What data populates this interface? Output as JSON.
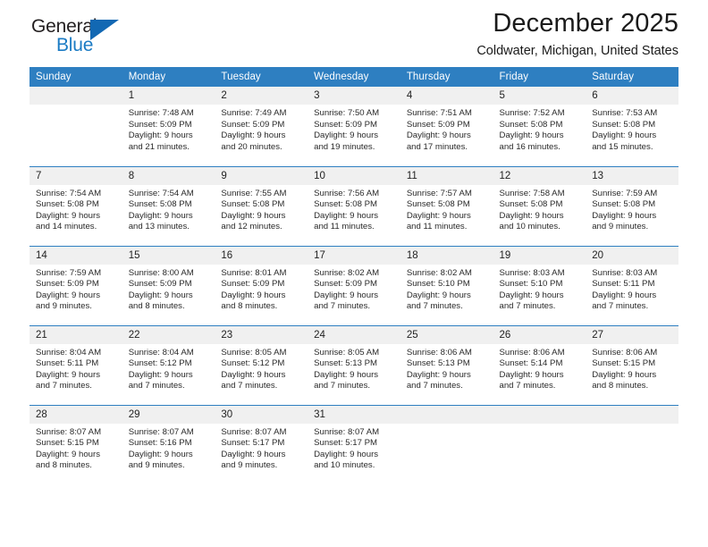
{
  "brand": {
    "name_part1": "General",
    "name_part2": "Blue",
    "triangle_color": "#1268b3",
    "blue_text_color": "#1b7bc4"
  },
  "header": {
    "month_title": "December 2025",
    "location": "Coldwater, Michigan, United States",
    "header_bg_color": "#2e7fc1",
    "daynum_bg_color": "#f0f0f0"
  },
  "weekday_headers": [
    "Sunday",
    "Monday",
    "Tuesday",
    "Wednesday",
    "Thursday",
    "Friday",
    "Saturday"
  ],
  "weeks": [
    [
      {
        "day": "",
        "sunrise": "",
        "sunset": "",
        "daylight1": "",
        "daylight2": ""
      },
      {
        "day": "1",
        "sunrise": "Sunrise: 7:48 AM",
        "sunset": "Sunset: 5:09 PM",
        "daylight1": "Daylight: 9 hours",
        "daylight2": "and 21 minutes."
      },
      {
        "day": "2",
        "sunrise": "Sunrise: 7:49 AM",
        "sunset": "Sunset: 5:09 PM",
        "daylight1": "Daylight: 9 hours",
        "daylight2": "and 20 minutes."
      },
      {
        "day": "3",
        "sunrise": "Sunrise: 7:50 AM",
        "sunset": "Sunset: 5:09 PM",
        "daylight1": "Daylight: 9 hours",
        "daylight2": "and 19 minutes."
      },
      {
        "day": "4",
        "sunrise": "Sunrise: 7:51 AM",
        "sunset": "Sunset: 5:09 PM",
        "daylight1": "Daylight: 9 hours",
        "daylight2": "and 17 minutes."
      },
      {
        "day": "5",
        "sunrise": "Sunrise: 7:52 AM",
        "sunset": "Sunset: 5:08 PM",
        "daylight1": "Daylight: 9 hours",
        "daylight2": "and 16 minutes."
      },
      {
        "day": "6",
        "sunrise": "Sunrise: 7:53 AM",
        "sunset": "Sunset: 5:08 PM",
        "daylight1": "Daylight: 9 hours",
        "daylight2": "and 15 minutes."
      }
    ],
    [
      {
        "day": "7",
        "sunrise": "Sunrise: 7:54 AM",
        "sunset": "Sunset: 5:08 PM",
        "daylight1": "Daylight: 9 hours",
        "daylight2": "and 14 minutes."
      },
      {
        "day": "8",
        "sunrise": "Sunrise: 7:54 AM",
        "sunset": "Sunset: 5:08 PM",
        "daylight1": "Daylight: 9 hours",
        "daylight2": "and 13 minutes."
      },
      {
        "day": "9",
        "sunrise": "Sunrise: 7:55 AM",
        "sunset": "Sunset: 5:08 PM",
        "daylight1": "Daylight: 9 hours",
        "daylight2": "and 12 minutes."
      },
      {
        "day": "10",
        "sunrise": "Sunrise: 7:56 AM",
        "sunset": "Sunset: 5:08 PM",
        "daylight1": "Daylight: 9 hours",
        "daylight2": "and 11 minutes."
      },
      {
        "day": "11",
        "sunrise": "Sunrise: 7:57 AM",
        "sunset": "Sunset: 5:08 PM",
        "daylight1": "Daylight: 9 hours",
        "daylight2": "and 11 minutes."
      },
      {
        "day": "12",
        "sunrise": "Sunrise: 7:58 AM",
        "sunset": "Sunset: 5:08 PM",
        "daylight1": "Daylight: 9 hours",
        "daylight2": "and 10 minutes."
      },
      {
        "day": "13",
        "sunrise": "Sunrise: 7:59 AM",
        "sunset": "Sunset: 5:08 PM",
        "daylight1": "Daylight: 9 hours",
        "daylight2": "and 9 minutes."
      }
    ],
    [
      {
        "day": "14",
        "sunrise": "Sunrise: 7:59 AM",
        "sunset": "Sunset: 5:09 PM",
        "daylight1": "Daylight: 9 hours",
        "daylight2": "and 9 minutes."
      },
      {
        "day": "15",
        "sunrise": "Sunrise: 8:00 AM",
        "sunset": "Sunset: 5:09 PM",
        "daylight1": "Daylight: 9 hours",
        "daylight2": "and 8 minutes."
      },
      {
        "day": "16",
        "sunrise": "Sunrise: 8:01 AM",
        "sunset": "Sunset: 5:09 PM",
        "daylight1": "Daylight: 9 hours",
        "daylight2": "and 8 minutes."
      },
      {
        "day": "17",
        "sunrise": "Sunrise: 8:02 AM",
        "sunset": "Sunset: 5:09 PM",
        "daylight1": "Daylight: 9 hours",
        "daylight2": "and 7 minutes."
      },
      {
        "day": "18",
        "sunrise": "Sunrise: 8:02 AM",
        "sunset": "Sunset: 5:10 PM",
        "daylight1": "Daylight: 9 hours",
        "daylight2": "and 7 minutes."
      },
      {
        "day": "19",
        "sunrise": "Sunrise: 8:03 AM",
        "sunset": "Sunset: 5:10 PM",
        "daylight1": "Daylight: 9 hours",
        "daylight2": "and 7 minutes."
      },
      {
        "day": "20",
        "sunrise": "Sunrise: 8:03 AM",
        "sunset": "Sunset: 5:11 PM",
        "daylight1": "Daylight: 9 hours",
        "daylight2": "and 7 minutes."
      }
    ],
    [
      {
        "day": "21",
        "sunrise": "Sunrise: 8:04 AM",
        "sunset": "Sunset: 5:11 PM",
        "daylight1": "Daylight: 9 hours",
        "daylight2": "and 7 minutes."
      },
      {
        "day": "22",
        "sunrise": "Sunrise: 8:04 AM",
        "sunset": "Sunset: 5:12 PM",
        "daylight1": "Daylight: 9 hours",
        "daylight2": "and 7 minutes."
      },
      {
        "day": "23",
        "sunrise": "Sunrise: 8:05 AM",
        "sunset": "Sunset: 5:12 PM",
        "daylight1": "Daylight: 9 hours",
        "daylight2": "and 7 minutes."
      },
      {
        "day": "24",
        "sunrise": "Sunrise: 8:05 AM",
        "sunset": "Sunset: 5:13 PM",
        "daylight1": "Daylight: 9 hours",
        "daylight2": "and 7 minutes."
      },
      {
        "day": "25",
        "sunrise": "Sunrise: 8:06 AM",
        "sunset": "Sunset: 5:13 PM",
        "daylight1": "Daylight: 9 hours",
        "daylight2": "and 7 minutes."
      },
      {
        "day": "26",
        "sunrise": "Sunrise: 8:06 AM",
        "sunset": "Sunset: 5:14 PM",
        "daylight1": "Daylight: 9 hours",
        "daylight2": "and 7 minutes."
      },
      {
        "day": "27",
        "sunrise": "Sunrise: 8:06 AM",
        "sunset": "Sunset: 5:15 PM",
        "daylight1": "Daylight: 9 hours",
        "daylight2": "and 8 minutes."
      }
    ],
    [
      {
        "day": "28",
        "sunrise": "Sunrise: 8:07 AM",
        "sunset": "Sunset: 5:15 PM",
        "daylight1": "Daylight: 9 hours",
        "daylight2": "and 8 minutes."
      },
      {
        "day": "29",
        "sunrise": "Sunrise: 8:07 AM",
        "sunset": "Sunset: 5:16 PM",
        "daylight1": "Daylight: 9 hours",
        "daylight2": "and 9 minutes."
      },
      {
        "day": "30",
        "sunrise": "Sunrise: 8:07 AM",
        "sunset": "Sunset: 5:17 PM",
        "daylight1": "Daylight: 9 hours",
        "daylight2": "and 9 minutes."
      },
      {
        "day": "31",
        "sunrise": "Sunrise: 8:07 AM",
        "sunset": "Sunset: 5:17 PM",
        "daylight1": "Daylight: 9 hours",
        "daylight2": "and 10 minutes."
      },
      {
        "day": "",
        "sunrise": "",
        "sunset": "",
        "daylight1": "",
        "daylight2": ""
      },
      {
        "day": "",
        "sunrise": "",
        "sunset": "",
        "daylight1": "",
        "daylight2": ""
      },
      {
        "day": "",
        "sunrise": "",
        "sunset": "",
        "daylight1": "",
        "daylight2": ""
      }
    ]
  ]
}
